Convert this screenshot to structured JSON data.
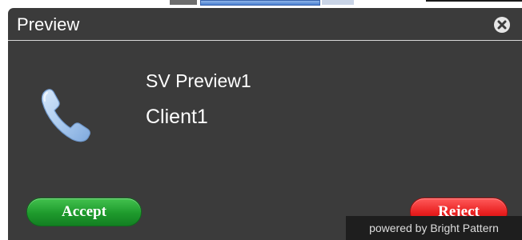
{
  "dialog": {
    "title": "Preview",
    "close_icon": "close-circle-icon"
  },
  "call": {
    "icon": "phone-handset-icon",
    "name": "SV Preview1",
    "client": "Client1"
  },
  "actions": {
    "accept_label": "Accept",
    "reject_label": "Reject"
  },
  "footer": {
    "powered_by": "powered by Bright Pattern"
  },
  "colors": {
    "dialog_bg": "#3b3b3b",
    "accept": "#1e9a2c",
    "reject": "#e81e1e",
    "phone_icon": "#a9c9ee"
  }
}
